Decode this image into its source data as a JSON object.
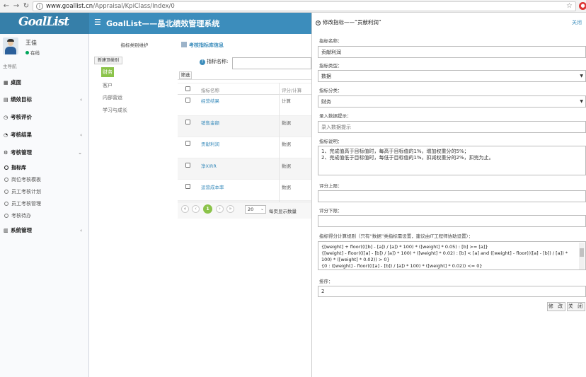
{
  "browser": {
    "url_host": "www.goallist.cn",
    "url_path": "/Appraisal/KpiClass/Index/0"
  },
  "header": {
    "logo": "GoalList",
    "title": "GoalList——晶北绩效管理系统"
  },
  "user": {
    "name": "王佳",
    "status": "在线"
  },
  "sidebar": {
    "nav_label": "主导航",
    "items": [
      {
        "label": "桌面",
        "icon": "grid-icon"
      },
      {
        "label": "绩效目标",
        "icon": "file-icon"
      },
      {
        "label": "考核评价",
        "icon": "clock-icon"
      },
      {
        "label": "考核结果",
        "icon": "dashboard-icon"
      },
      {
        "label": "考核管理",
        "icon": "gears-icon"
      },
      {
        "label": "系统管理",
        "icon": "book-icon"
      }
    ],
    "subitems": [
      "指标库",
      "岗位考核模板",
      "员工考核计划",
      "员工考核管理",
      "考核待办"
    ],
    "active_sub": "指标库"
  },
  "content": {
    "tab_mgmt": "指标类别维护",
    "tab_lib": "考核指标库信息",
    "new_category": "新建顶类别",
    "categories": [
      "财务",
      "客户",
      "内部营运",
      "学习与成长"
    ],
    "search_label": "指标名称:",
    "filter_btn": "筛选",
    "table": {
      "headers": [
        "指标名称",
        "评分/计算"
      ],
      "rows": [
        {
          "name": "经营结果",
          "type": "计算"
        },
        {
          "name": "销售金额",
          "type": "数据"
        },
        {
          "name": "贡献利润",
          "type": "数据"
        },
        {
          "name": "净XIRR",
          "type": "数据"
        },
        {
          "name": "运营成本率",
          "type": "数据"
        }
      ]
    },
    "pager": {
      "current": "1",
      "page_size": "20",
      "size_label": "每页显示数量"
    }
  },
  "panel": {
    "title": "修改指标——“贡献利润”",
    "close": "关闭",
    "name_label": "指标名称：",
    "name_value": "贡献利润",
    "type_label": "指标类型：",
    "type_value": "数据",
    "category_label": "指标分类：",
    "category_value": "财务",
    "hint_label": "录入数据提示：",
    "hint_placeholder": "录入数据提示",
    "desc_label": "指标说明：",
    "desc_lines": [
      "1、完成值高于目标值时，每高于目标值的1%，增加权重分的5%；",
      "2、完成值低于目标值时，每低于目标值的1%，扣减权重分的2%，扣完为止。"
    ],
    "upper_label": "评分上限：",
    "lower_label": "评分下限：",
    "rule_label": "指标得分计算规则（只有“数据”类指标需设置，建议由IT工程师协助设置）：",
    "rule_lines": [
      "{[weight] + floor((([b] - [a]) / [a]) * 100) * ([weight] * 0.05) : [b] >= [a]}",
      "{[weight] - floor((([a] - [b]) / [a]) * 100) * ([weight] * 0.02) : [b] < [a] and ([weight] - floor((([a] - [b]) / [a]) * 100) * ([weight] * 0.02)) > 0}",
      "{0 : ([weight] - floor((([a] - [b]) / [a]) * 100) * ([weight] * 0.02)) <= 0}"
    ],
    "order_label": "排序：",
    "order_value": "2",
    "btn_edit": "修 改",
    "btn_close": "关 闭"
  }
}
